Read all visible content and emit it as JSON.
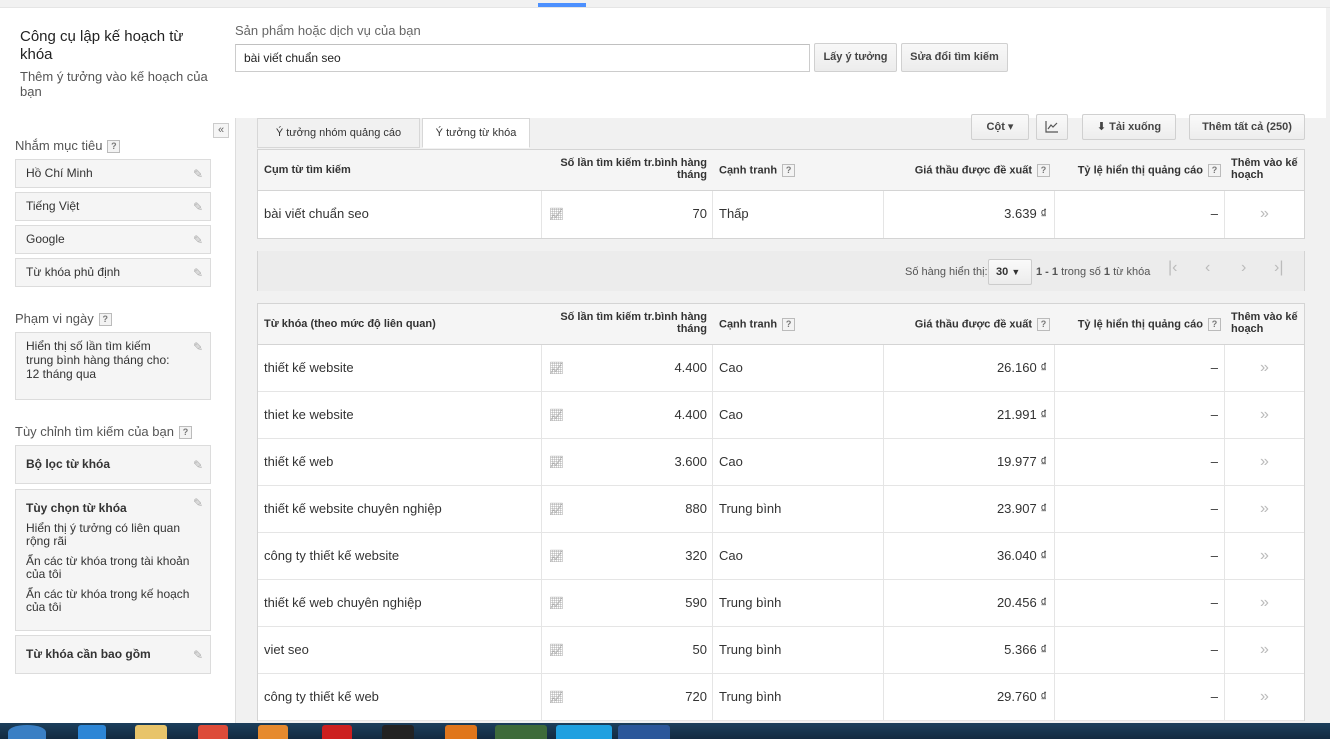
{
  "header": {
    "title": "Công cụ lập kế hoạch từ khóa",
    "subtitle": "Thêm ý tưởng vào kế hoạch của bạn",
    "product_label": "Sản phẩm hoặc dịch vụ của bạn",
    "product_value": "bài viết chuẩn seo",
    "get_ideas": "Lấy ý tưởng",
    "modify_search": "Sửa đổi tìm kiếm"
  },
  "sidebar": {
    "collapse_glyph": "«",
    "targeting_heading": "Nhắm mục tiêu",
    "targeting": [
      "Hồ Chí Minh",
      "Tiếng Việt",
      "Google",
      "Từ khóa phủ định"
    ],
    "date_heading": "Phạm vi ngày",
    "date_value": "Hiển thị số lần tìm kiếm trung bình hàng tháng cho: 12 tháng qua",
    "custom_heading": "Tùy chỉnh tìm kiếm của bạn",
    "filter_label": "Bộ lọc từ khóa",
    "options_label": "Tùy chọn từ khóa",
    "options_items": [
      "Hiển thị ý tưởng có liên quan rộng rãi",
      "Ẩn các từ khóa trong tài khoản của tôi",
      "Ẩn các từ khóa trong kế hoạch của tôi"
    ],
    "include_label": "Từ khóa cần bao gồm"
  },
  "tabs": [
    "Ý tưởng nhóm quảng cáo",
    "Ý tưởng từ khóa"
  ],
  "toolbar": {
    "columns": "Cột ▾",
    "download": "Tải xuống",
    "add_all": "Thêm tất cả (250)"
  },
  "columns": {
    "search_term": "Cụm từ tìm kiếm",
    "keyword": "Từ khóa (theo mức độ liên quan)",
    "volume": "Số lần tìm kiếm tr.bình hàng tháng",
    "competition": "Cạnh tranh",
    "bid": "Giá thầu được đề xuất",
    "impr_share": "Tỷ lệ hiển thị quảng cáo",
    "add": "Thêm vào kế hoạch"
  },
  "search_terms": [
    {
      "keyword": "bài viết chuẩn seo",
      "volume": "70",
      "competition": "Thấp",
      "bid": "3.639 ₫",
      "share": "–"
    }
  ],
  "pager": {
    "rows_label": "Số hàng hiển thị:",
    "rows_value": "30",
    "range_a": "1 - 1",
    "range_mid": "trong số",
    "range_b": "1",
    "range_unit": "từ khóa"
  },
  "keywords": [
    {
      "keyword": "thiết kế website",
      "volume": "4.400",
      "competition": "Cao",
      "bid": "26.160 ₫",
      "share": "–"
    },
    {
      "keyword": "thiet ke website",
      "volume": "4.400",
      "competition": "Cao",
      "bid": "21.991 ₫",
      "share": "–"
    },
    {
      "keyword": "thiết kế web",
      "volume": "3.600",
      "competition": "Cao",
      "bid": "19.977 ₫",
      "share": "–"
    },
    {
      "keyword": "thiết kế website chuyên nghiệp",
      "volume": "880",
      "competition": "Trung bình",
      "bid": "23.907 ₫",
      "share": "–"
    },
    {
      "keyword": "công ty thiết kế website",
      "volume": "320",
      "competition": "Cao",
      "bid": "36.040 ₫",
      "share": "–"
    },
    {
      "keyword": "thiết kế web chuyên nghiệp",
      "volume": "590",
      "competition": "Trung bình",
      "bid": "20.456 ₫",
      "share": "–"
    },
    {
      "keyword": "viet seo",
      "volume": "50",
      "competition": "Trung bình",
      "bid": "5.366 ₫",
      "share": "–"
    },
    {
      "keyword": "công ty thiết kế web",
      "volume": "720",
      "competition": "Trung bình",
      "bid": "29.760 ₫",
      "share": "–"
    }
  ],
  "colors": {
    "accent": "#4d90fe",
    "taskbar": "#1c3f5c"
  }
}
